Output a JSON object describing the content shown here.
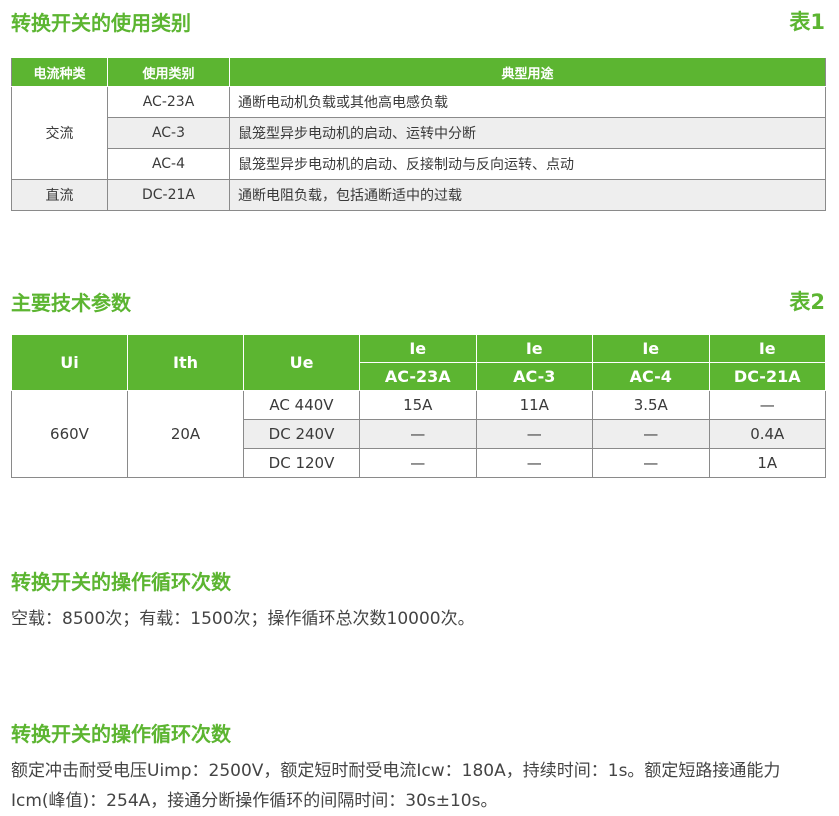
{
  "section1": {
    "title": "转换开关的使用类别",
    "tag": "表1"
  },
  "table1": {
    "headers": [
      "电流种类",
      "使用类别",
      "典型用途"
    ],
    "ac_label": "交流",
    "dc_label": "直流",
    "rows": [
      {
        "category": "AC-23A",
        "use": "通断电动机负载或其他高电感负载"
      },
      {
        "category": "AC-3",
        "use": "鼠笼型异步电动机的启动、运转中分断"
      },
      {
        "category": "AC-4",
        "use": "鼠笼型异步电动机的启动、反接制动与反向运转、点动"
      },
      {
        "category": "DC-21A",
        "use": "通断电阻负载，包括通断适中的过载"
      }
    ]
  },
  "section2": {
    "title": "主要技术参数",
    "tag": "表2"
  },
  "table2": {
    "headers": {
      "ui": "Ui",
      "ith": "Ith",
      "ue": "Ue",
      "ie": "Ie"
    },
    "subheaders": [
      "AC-23A",
      "AC-3",
      "AC-4",
      "DC-21A"
    ],
    "ui_value": "660V",
    "ith_value": "20A",
    "rows": [
      {
        "ue": "AC 440V",
        "values": [
          "15A",
          "11A",
          "3.5A",
          "—"
        ]
      },
      {
        "ue": "DC 240V",
        "values": [
          "—",
          "—",
          "—",
          "0.4A"
        ]
      },
      {
        "ue": "DC 120V",
        "values": [
          "—",
          "—",
          "—",
          "1A"
        ]
      }
    ]
  },
  "section3": {
    "title": "转换开关的操作循环次数",
    "text": "空载：8500次；有载：1500次；操作循环总次数10000次。"
  },
  "section4": {
    "title": "转换开关的操作循环次数",
    "text": "额定冲击耐受电压Uimp：2500V，额定短时耐受电流Icw：180A，持续时间：1s。额定短路接通能力Icm(峰值)：254A，接通分断操作循环的间隔时间：30s±10s。"
  }
}
